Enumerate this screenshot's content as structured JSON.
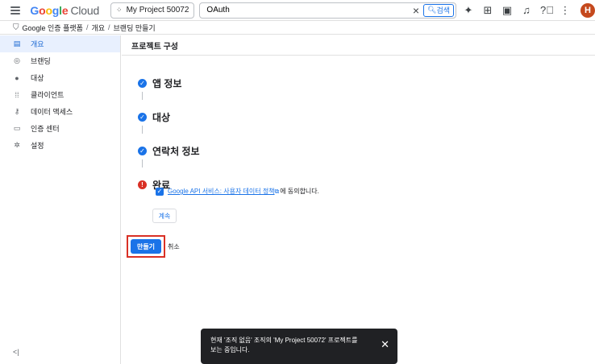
{
  "topbar": {
    "logo": {
      "g1": "G",
      "o1": "o",
      "o2": "o",
      "g2": "g",
      "l": "l",
      "e": "e",
      "cloud": "Cloud"
    },
    "project": "My Project 50072",
    "search_value": "OAuth",
    "search_button": "검색",
    "avatar_letter": "H"
  },
  "breadcrumb": {
    "items": [
      "Google 인증 플랫폼",
      "개요",
      "브랜딩 만들기"
    ]
  },
  "sidebar": {
    "items": [
      {
        "label": "개요",
        "icon": "grid-icon",
        "active": true
      },
      {
        "label": "브랜딩",
        "icon": "palette-icon"
      },
      {
        "label": "대상",
        "icon": "person-icon"
      },
      {
        "label": "클라이언트",
        "icon": "apps-icon"
      },
      {
        "label": "데이터 액세스",
        "icon": "key-icon"
      },
      {
        "label": "인증 센터",
        "icon": "calendar-icon"
      },
      {
        "label": "설정",
        "icon": "gear-icon"
      }
    ],
    "collapse": "<|"
  },
  "main": {
    "title": "프로젝트 구성",
    "steps": [
      {
        "title": "앱 정보",
        "status": "done"
      },
      {
        "title": "대상",
        "status": "done"
      },
      {
        "title": "연락처 정보",
        "status": "done"
      },
      {
        "title": "완료",
        "status": "warning"
      }
    ],
    "consent_link": "Google API 서비스: 사용자 데이터 정책",
    "consent_suffix": "에 동의합니다.",
    "continue_label": "계속",
    "create_label": "만들기",
    "cancel_label": "취소"
  },
  "snackbar": {
    "line1": "현재 '조직 없음' 조직의 'My Project 50072' 프로젝트를",
    "line2": "보는 중입니다."
  },
  "colors": {
    "accent": "#1a73e8",
    "error": "#d93025",
    "avatar": "#c5491d"
  }
}
